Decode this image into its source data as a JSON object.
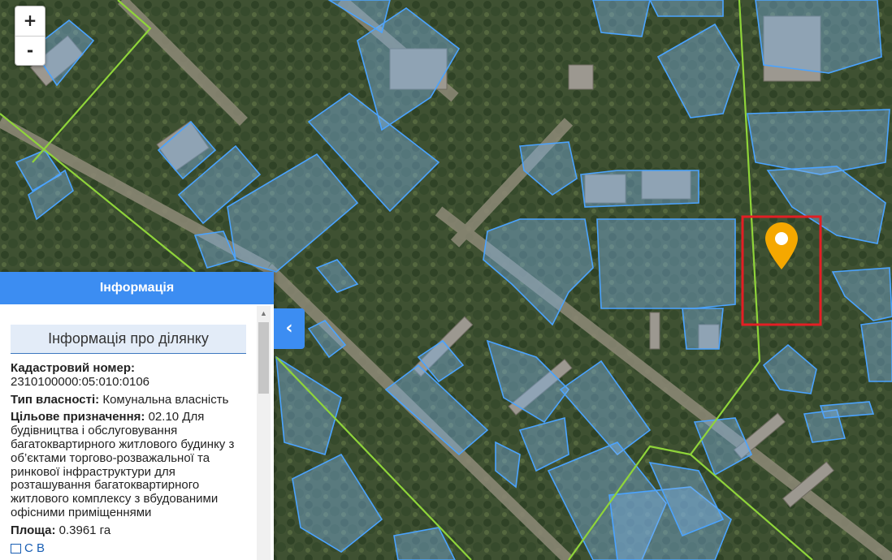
{
  "map": {
    "zoom_in_label": "+",
    "zoom_out_label": "-",
    "colors": {
      "imagery": "#4a5a3a",
      "parcel_fill": "#7fb3e6",
      "parcel_stroke": "#4aa3ff",
      "boundary": "#8fd43a",
      "selection": "#e31e24",
      "marker": "#f5a800"
    }
  },
  "panel": {
    "header": "Інформація",
    "collapse_icon": "‹",
    "section_title": "Інформація про ділянку",
    "cadastral_label": "Кадастровий номер:",
    "cadastral_value": "2310100000:05:010:0106",
    "ownership_label": "Тип власності:",
    "ownership_value": "Комунальна власність",
    "purpose_label": "Цільове призначення:",
    "purpose_value": "02.10 Для будівництва і обслуговування багатоквартирного житлового будинку з об’єктами торгово-розважальної та ринкової інфраструктури для розташування багатоквартирного житлового комплексу з вбудованими офісними приміщеннями",
    "area_label": "Площа:",
    "area_value": "0.3961 га",
    "link_partial": "С         В"
  }
}
